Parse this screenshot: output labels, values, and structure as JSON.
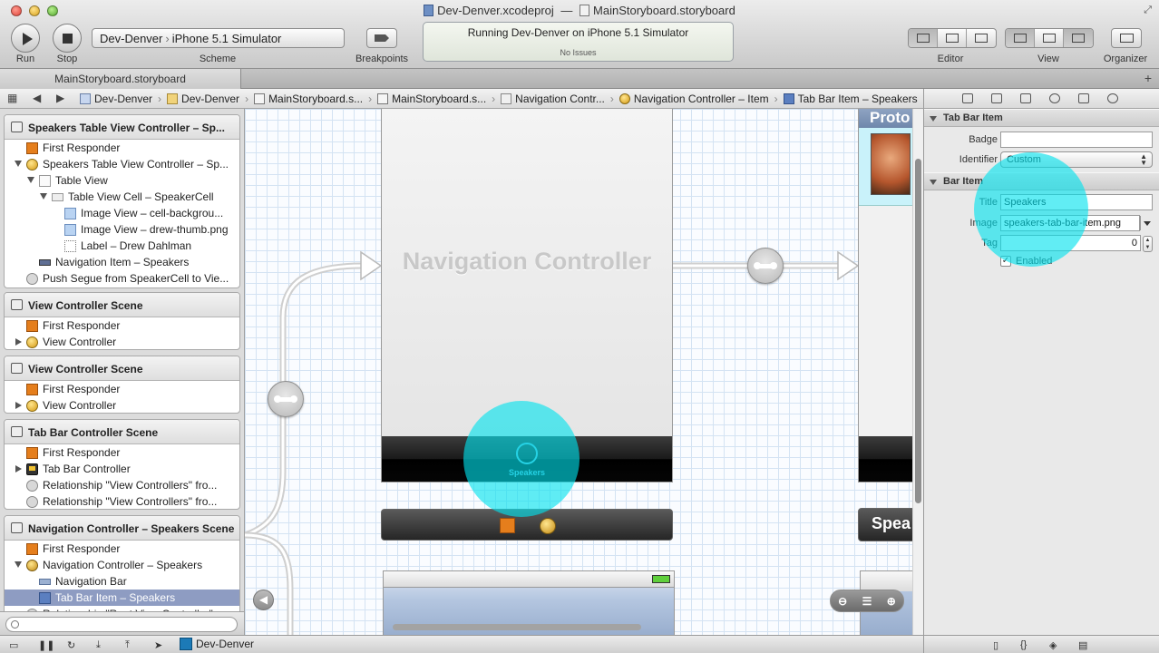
{
  "window": {
    "project_file": "Dev-Denver.xcodeproj",
    "separator": "—",
    "storyboard_file": "MainStoryboard.storyboard"
  },
  "toolbar": {
    "run_label": "Run",
    "stop_label": "Stop",
    "scheme_target": "Dev-Denver",
    "scheme_destination": "iPhone 5.1 Simulator",
    "scheme_label": "Scheme",
    "breakpoints_label": "Breakpoints",
    "activity_status": "Running Dev-Denver on iPhone 5.1 Simulator",
    "activity_issues": "No Issues",
    "editor_label": "Editor",
    "view_label": "View",
    "organizer_label": "Organizer"
  },
  "tabs": [
    {
      "label": "MainStoryboard.storyboard"
    }
  ],
  "jumpbar": {
    "crumbs": [
      {
        "icon": "project-icon",
        "label": "Dev-Denver"
      },
      {
        "icon": "folder-icon",
        "label": "Dev-Denver"
      },
      {
        "icon": "storyboard-icon",
        "label": "MainStoryboard.s..."
      },
      {
        "icon": "storyboard-icon",
        "label": "MainStoryboard.s..."
      },
      {
        "icon": "navigation-scene-icon",
        "label": "Navigation Contr..."
      },
      {
        "icon": "navigation-controller-icon",
        "label": "Navigation Controller – Item"
      },
      {
        "icon": "tab-bar-item-icon",
        "label": "Tab Bar Item – Speakers"
      }
    ]
  },
  "outline": {
    "scenes": [
      {
        "title": "Speakers Table View Controller – Sp...",
        "rows": [
          {
            "label": "First Responder",
            "icon": "first-responder-icon"
          },
          {
            "label": "Speakers Table View Controller – Sp...",
            "icon": "view-controller-icon"
          },
          {
            "label": "Table View",
            "icon": "table-view-icon"
          },
          {
            "label": "Table View Cell – SpeakerCell",
            "icon": "table-cell-icon"
          },
          {
            "label": "Image View – cell-backgrou...",
            "icon": "image-view-icon"
          },
          {
            "label": "Image View – drew-thumb.png",
            "icon": "image-view-icon"
          },
          {
            "label": "Label – Drew Dahlman",
            "icon": "label-icon"
          },
          {
            "label": "Navigation Item – Speakers",
            "icon": "navigation-item-icon"
          },
          {
            "label": "Push Segue from SpeakerCell to Vie...",
            "icon": "segue-icon"
          }
        ]
      },
      {
        "title": "View Controller Scene",
        "rows": [
          {
            "label": "First Responder",
            "icon": "first-responder-icon"
          },
          {
            "label": "View Controller",
            "icon": "view-controller-icon"
          }
        ]
      },
      {
        "title": "View Controller Scene",
        "rows": [
          {
            "label": "First Responder",
            "icon": "first-responder-icon"
          },
          {
            "label": "View Controller",
            "icon": "view-controller-icon"
          }
        ]
      },
      {
        "title": "Tab Bar Controller Scene",
        "rows": [
          {
            "label": "First Responder",
            "icon": "first-responder-icon"
          },
          {
            "label": "Tab Bar Controller",
            "icon": "tab-bar-controller-icon"
          },
          {
            "label": "Relationship \"View Controllers\" fro...",
            "icon": "segue-icon"
          },
          {
            "label": "Relationship \"View Controllers\" fro...",
            "icon": "segue-icon"
          }
        ]
      },
      {
        "title": "Navigation Controller – Speakers Scene",
        "rows": [
          {
            "label": "First Responder",
            "icon": "first-responder-icon"
          },
          {
            "label": "Navigation Controller – Speakers",
            "icon": "navigation-controller-icon"
          },
          {
            "label": "Navigation Bar",
            "icon": "navigation-bar-icon"
          },
          {
            "label": "Tab Bar Item – Speakers",
            "icon": "tab-bar-item-icon",
            "selected": true
          },
          {
            "label": "Relationship \"Root View Controller\"...",
            "icon": "segue-icon"
          }
        ]
      }
    ]
  },
  "canvas": {
    "nav_controller_title": "Navigation Controller",
    "tab_item_label": "Speakers",
    "right_scene_header": "Proto",
    "right_dock_label": "Spea"
  },
  "inspector": {
    "section_tab_bar_item": "Tab Bar Item",
    "badge_label": "Badge",
    "badge_value": "",
    "identifier_label": "Identifier",
    "identifier_value": "Custom",
    "section_bar_item": "Bar Item",
    "title_label": "Title",
    "title_value": "Speakers",
    "image_label": "Image",
    "image_value": "speakers-tab-bar-item.png",
    "tag_label": "Tag",
    "tag_value": "0",
    "enabled_label": "Enabled",
    "enabled": true
  },
  "debug": {
    "target_label": "Dev-Denver"
  },
  "colors": {
    "highlight": "#00e2ee",
    "selection": "#8e9cc2",
    "tab_item_tint": "#62b7d8"
  }
}
